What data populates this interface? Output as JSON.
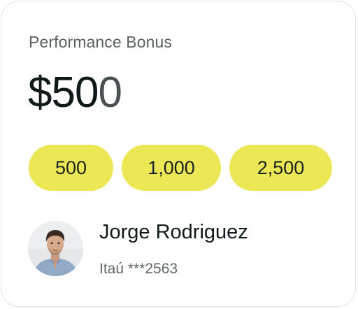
{
  "card": {
    "title": "Performance Bonus",
    "amount_main": "$50",
    "amount_tail": "0"
  },
  "presets": [
    {
      "label": "500"
    },
    {
      "label": "1,000"
    },
    {
      "label": "2,500"
    }
  ],
  "recipient": {
    "name": "Jorge Rodriguez",
    "account": "Itaú ***2563"
  },
  "colors": {
    "chip_bg": "#ebe755",
    "text_primary": "#111a1a",
    "text_secondary": "#5a5f60"
  }
}
